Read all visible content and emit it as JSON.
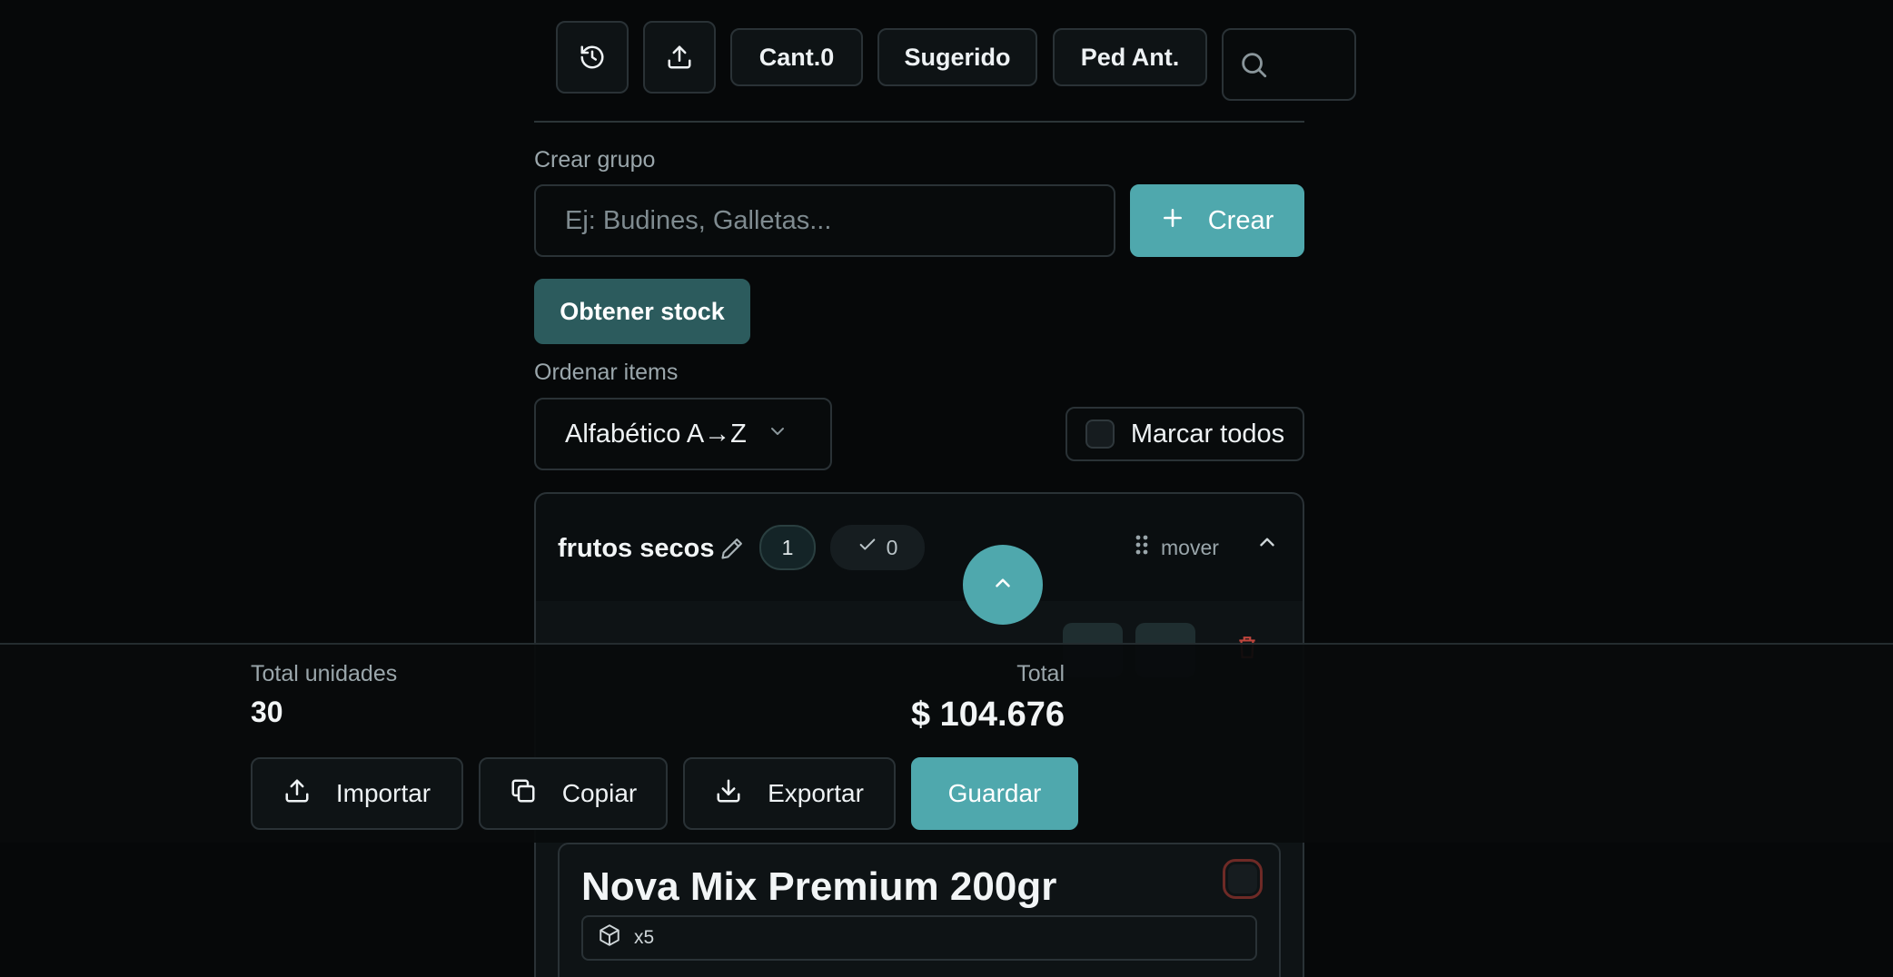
{
  "toolbar": {
    "history_icon": "history-icon",
    "upload_icon": "upload-icon",
    "qty_label": "Cant.0",
    "suggested_label": "Sugerido",
    "prev_order_label": "Ped Ant.",
    "search_icon": "search-icon"
  },
  "create_group": {
    "label": "Crear grupo",
    "placeholder": "Ej: Budines, Galletas...",
    "button_label": "Crear"
  },
  "stock_button_label": "Obtener stock",
  "sort": {
    "label": "Ordenar items",
    "selected": "Alfabético A→Z",
    "mark_all_label": "Marcar todos"
  },
  "group": {
    "name": "frutos secos",
    "item_count": "1",
    "checked_count": "0",
    "move_label": "mover"
  },
  "totals": {
    "units_label": "Total unidades",
    "units_value": "30",
    "total_label": "Total",
    "total_value": "$ 104.676"
  },
  "actions": {
    "import_label": "Importar",
    "copy_label": "Copiar",
    "export_label": "Exportar",
    "save_label": "Guardar"
  },
  "item": {
    "name": "Nova Mix Premium 200gr",
    "pack_label": "x5"
  },
  "colors": {
    "accent": "#4fa8ad",
    "accent_dark": "#2c5b5d",
    "background": "#060809",
    "danger": "#b5443c"
  }
}
